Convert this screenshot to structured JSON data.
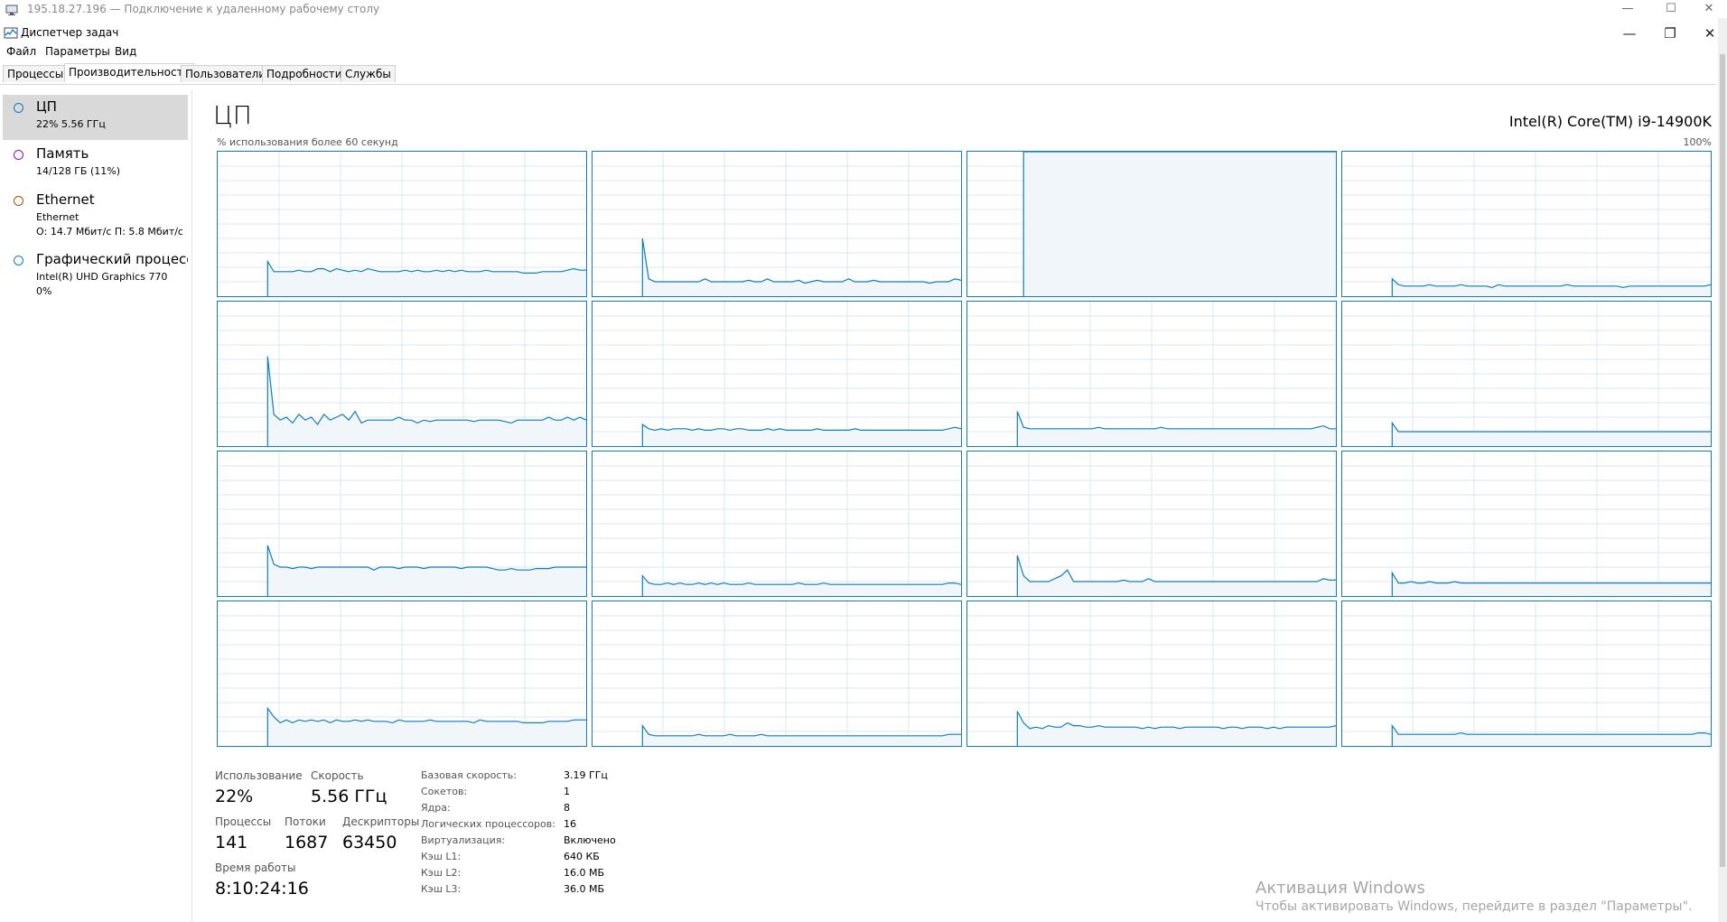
{
  "rdp": {
    "title": "195.18.27.196 — Подключение к удаленному рабочему столу",
    "minimize": "—",
    "maximize": "☐",
    "close": "✕"
  },
  "app": {
    "title": "Диспетчер задач",
    "minimize": "—",
    "restore": "❐",
    "close": "✕"
  },
  "menu": [
    "Файл",
    "Параметры",
    "Вид"
  ],
  "tabs": [
    "Процессы",
    "Производительность",
    "Пользователи",
    "Подробности",
    "Службы"
  ],
  "active_tab": "Производительность",
  "sidebar": {
    "items": [
      {
        "title": "ЦП",
        "sub1": "22%  5.56 ГГц",
        "sub2": "",
        "color": "#117dbb",
        "icon": "cpu-circle-icon"
      },
      {
        "title": "Память",
        "sub1": "14/128 ГБ (11%)",
        "sub2": "",
        "color": "#8b12ae",
        "icon": "memory-circle-icon"
      },
      {
        "title": "Ethernet",
        "sub1": "Ethernet",
        "sub2": "О: 14.7 Мбит/с  П: 5.8 Мбит/с",
        "color": "#a74f01",
        "icon": "ethernet-circle-icon"
      },
      {
        "title": "Графический процессор",
        "sub1": "Intel(R) UHD Graphics 770",
        "sub2": "0%",
        "color": "#117dbb",
        "icon": "gpu-circle-icon"
      }
    ]
  },
  "main": {
    "title": "ЦП",
    "cpu_name": "Intel(R) Core(TM) i9-14900K",
    "graph_caption": "% использования более 60 секунд",
    "graph_max": "100%"
  },
  "stats": {
    "usage_label": "Использование",
    "usage_value": "22%",
    "speed_label": "Скорость",
    "speed_value": "5.56 ГГц",
    "processes_label": "Процессы",
    "processes_value": "141",
    "threads_label": "Потоки",
    "threads_value": "1687",
    "handles_label": "Дескрипторы",
    "handles_value": "63450",
    "uptime_label": "Время работы",
    "uptime_value": "8:10:24:16"
  },
  "specs": [
    {
      "label": "Базовая скорость:",
      "value": "3.19 ГГц"
    },
    {
      "label": "Сокетов:",
      "value": "1"
    },
    {
      "label": "Ядра:",
      "value": "8"
    },
    {
      "label": "Логических процессоров:",
      "value": "16"
    },
    {
      "label": "Виртуализация:",
      "value": "Включено"
    },
    {
      "label": "Кэш L1:",
      "value": "640 КБ"
    },
    {
      "label": "Кэш L2:",
      "value": "16.0 МБ"
    },
    {
      "label": "Кэш L3:",
      "value": "36.0 МБ"
    }
  ],
  "activation": {
    "title": "Активация Windows",
    "subtitle": "Чтобы активировать Windows, перейдите в раздел \"Параметры\"."
  },
  "colors": {
    "graph_line": "#117dbb",
    "graph_fill": "#f1f6fa",
    "grid": "#d9eaf4",
    "selected": "#d9d9d9"
  },
  "chart_data": {
    "type": "area",
    "title": "% использования более 60 секунд",
    "ylim": [
      0,
      100
    ],
    "grid": true,
    "x_samples": 60,
    "series": [
      {
        "values": [
          0,
          0,
          0,
          0,
          0,
          0,
          0,
          0,
          24,
          17,
          17,
          17,
          17,
          18,
          17,
          17,
          19,
          19,
          17,
          19,
          18,
          17,
          18,
          17,
          19,
          18,
          17,
          17,
          17,
          17,
          18,
          17,
          18,
          17,
          17,
          18,
          17,
          18,
          17,
          18,
          17,
          17,
          17,
          18,
          17,
          17,
          17,
          17,
          17,
          16,
          16,
          16,
          17,
          17,
          17,
          17,
          18,
          19,
          18,
          18
        ]
      },
      {
        "values": [
          0,
          0,
          0,
          0,
          0,
          0,
          0,
          0,
          40,
          12,
          10,
          10,
          10,
          10,
          10,
          10,
          10,
          10,
          12,
          10,
          10,
          10,
          10,
          10,
          10,
          11,
          10,
          10,
          12,
          10,
          10,
          10,
          10,
          11,
          9,
          10,
          11,
          10,
          10,
          10,
          10,
          12,
          10,
          10,
          10,
          11,
          10,
          10,
          10,
          10,
          10,
          10,
          10,
          10,
          9,
          10,
          10,
          10,
          12,
          11
        ]
      },
      {
        "values": [
          0,
          0,
          0,
          0,
          0,
          0,
          0,
          0,
          0,
          100,
          100,
          100,
          100,
          100,
          100,
          100,
          100,
          100,
          100,
          100,
          100,
          100,
          100,
          100,
          100,
          100,
          100,
          100,
          100,
          100,
          100,
          100,
          100,
          100,
          100,
          100,
          100,
          100,
          100,
          100,
          100,
          100,
          100,
          100,
          100,
          100,
          100,
          100,
          100,
          100,
          100,
          100,
          100,
          100,
          100,
          100,
          100,
          100,
          100,
          100
        ]
      },
      {
        "values": [
          0,
          0,
          0,
          0,
          0,
          0,
          0,
          0,
          12,
          8,
          7,
          7,
          7,
          7,
          8,
          7,
          7,
          7,
          7,
          8,
          7,
          7,
          7,
          7,
          6,
          8,
          7,
          7,
          7,
          7,
          7,
          7,
          7,
          7,
          7,
          7,
          8,
          7,
          7,
          7,
          7,
          7,
          7,
          7,
          7,
          6,
          7,
          7,
          7,
          7,
          7,
          7,
          7,
          7,
          7,
          7,
          7,
          7,
          7,
          8
        ]
      },
      {
        "values": [
          0,
          0,
          0,
          0,
          0,
          0,
          0,
          0,
          62,
          22,
          18,
          20,
          16,
          22,
          18,
          20,
          15,
          22,
          18,
          20,
          22,
          18,
          24,
          16,
          18,
          18,
          18,
          18,
          18,
          20,
          18,
          18,
          16,
          18,
          17,
          18,
          18,
          18,
          18,
          18,
          18,
          17,
          18,
          18,
          18,
          18,
          17,
          16,
          18,
          18,
          18,
          18,
          18,
          20,
          18,
          18,
          20,
          18,
          20,
          18
        ]
      },
      {
        "values": [
          0,
          0,
          0,
          0,
          0,
          0,
          0,
          0,
          15,
          12,
          11,
          12,
          11,
          12,
          12,
          12,
          11,
          12,
          11,
          11,
          12,
          12,
          11,
          12,
          12,
          11,
          11,
          11,
          12,
          11,
          12,
          11,
          11,
          11,
          11,
          11,
          12,
          11,
          11,
          11,
          11,
          11,
          12,
          11,
          11,
          11,
          11,
          11,
          11,
          11,
          11,
          11,
          11,
          11,
          11,
          11,
          11,
          12,
          13,
          12
        ]
      },
      {
        "values": [
          0,
          0,
          0,
          0,
          0,
          0,
          0,
          0,
          24,
          13,
          12,
          12,
          12,
          12,
          12,
          12,
          12,
          12,
          12,
          12,
          12,
          13,
          12,
          12,
          12,
          12,
          12,
          12,
          12,
          12,
          12,
          13,
          12,
          12,
          12,
          12,
          12,
          12,
          12,
          12,
          12,
          12,
          12,
          12,
          12,
          12,
          12,
          12,
          12,
          12,
          12,
          12,
          12,
          12,
          12,
          12,
          13,
          14,
          12,
          12
        ]
      },
      {
        "values": [
          0,
          0,
          0,
          0,
          0,
          0,
          0,
          0,
          16,
          10,
          10,
          10,
          10,
          10,
          10,
          10,
          10,
          10,
          10,
          10,
          10,
          10,
          10,
          10,
          10,
          10,
          10,
          10,
          10,
          10,
          10,
          10,
          10,
          10,
          10,
          10,
          10,
          10,
          10,
          10,
          10,
          10,
          10,
          10,
          10,
          10,
          10,
          10,
          10,
          10,
          10,
          10,
          10,
          10,
          10,
          10,
          10,
          10,
          10,
          10
        ]
      },
      {
        "values": [
          0,
          0,
          0,
          0,
          0,
          0,
          0,
          0,
          35,
          22,
          20,
          20,
          19,
          20,
          20,
          19,
          20,
          20,
          20,
          20,
          20,
          20,
          20,
          20,
          20,
          18,
          20,
          20,
          20,
          19,
          20,
          20,
          20,
          19,
          20,
          20,
          20,
          20,
          20,
          19,
          20,
          20,
          20,
          20,
          19,
          18,
          18,
          19,
          18,
          18,
          18,
          19,
          19,
          19,
          20,
          20,
          20,
          20,
          20,
          20
        ]
      },
      {
        "values": [
          0,
          0,
          0,
          0,
          0,
          0,
          0,
          0,
          14,
          9,
          8,
          8,
          9,
          8,
          9,
          8,
          8,
          9,
          8,
          9,
          8,
          9,
          8,
          8,
          8,
          9,
          8,
          8,
          8,
          8,
          8,
          8,
          8,
          9,
          8,
          8,
          8,
          9,
          8,
          8,
          8,
          8,
          8,
          8,
          8,
          8,
          8,
          8,
          8,
          8,
          8,
          8,
          8,
          8,
          8,
          8,
          8,
          9,
          9,
          8
        ]
      },
      {
        "values": [
          0,
          0,
          0,
          0,
          0,
          0,
          0,
          0,
          28,
          14,
          10,
          10,
          10,
          10,
          12,
          14,
          18,
          10,
          10,
          10,
          10,
          10,
          10,
          10,
          10,
          11,
          10,
          10,
          10,
          12,
          10,
          10,
          10,
          10,
          10,
          10,
          10,
          10,
          10,
          10,
          10,
          10,
          10,
          10,
          10,
          10,
          10,
          10,
          10,
          10,
          10,
          10,
          10,
          10,
          10,
          10,
          10,
          12,
          11,
          11
        ]
      },
      {
        "values": [
          0,
          0,
          0,
          0,
          0,
          0,
          0,
          0,
          16,
          9,
          9,
          10,
          9,
          9,
          10,
          9,
          9,
          9,
          10,
          9,
          9,
          9,
          9,
          9,
          9,
          9,
          9,
          9,
          9,
          9,
          9,
          9,
          9,
          9,
          9,
          9,
          9,
          9,
          9,
          9,
          9,
          9,
          9,
          9,
          9,
          9,
          9,
          9,
          9,
          9,
          9,
          9,
          9,
          9,
          9,
          9,
          9,
          9,
          9,
          9
        ]
      },
      {
        "values": [
          0,
          0,
          0,
          0,
          0,
          0,
          0,
          0,
          26,
          20,
          16,
          18,
          16,
          18,
          17,
          18,
          17,
          18,
          16,
          18,
          17,
          17,
          18,
          17,
          18,
          17,
          17,
          17,
          16,
          18,
          17,
          17,
          17,
          17,
          18,
          17,
          17,
          17,
          17,
          17,
          17,
          16,
          18,
          17,
          17,
          17,
          17,
          17,
          17,
          16,
          16,
          16,
          16,
          17,
          17,
          17,
          17,
          18,
          18,
          18
        ]
      },
      {
        "values": [
          0,
          0,
          0,
          0,
          0,
          0,
          0,
          0,
          14,
          8,
          7,
          7,
          7,
          7,
          7,
          7,
          7,
          8,
          7,
          7,
          7,
          7,
          8,
          7,
          7,
          7,
          7,
          8,
          7,
          7,
          7,
          7,
          7,
          7,
          7,
          7,
          7,
          7,
          7,
          7,
          7,
          7,
          7,
          7,
          7,
          7,
          7,
          7,
          7,
          7,
          7,
          7,
          7,
          7,
          7,
          7,
          7,
          8,
          8,
          8
        ]
      },
      {
        "values": [
          0,
          0,
          0,
          0,
          0,
          0,
          0,
          0,
          24,
          16,
          12,
          13,
          12,
          14,
          13,
          13,
          16,
          14,
          14,
          13,
          13,
          14,
          13,
          13,
          13,
          13,
          13,
          13,
          12,
          13,
          12,
          13,
          13,
          13,
          12,
          13,
          13,
          13,
          13,
          13,
          13,
          12,
          13,
          13,
          12,
          13,
          13,
          13,
          12,
          13,
          12,
          13,
          13,
          13,
          13,
          13,
          13,
          13,
          13,
          14
        ]
      },
      {
        "values": [
          0,
          0,
          0,
          0,
          0,
          0,
          0,
          0,
          14,
          8,
          8,
          8,
          8,
          8,
          8,
          8,
          8,
          8,
          8,
          9,
          8,
          8,
          8,
          8,
          8,
          8,
          8,
          8,
          8,
          8,
          8,
          8,
          8,
          8,
          8,
          8,
          8,
          8,
          8,
          8,
          8,
          8,
          8,
          8,
          8,
          8,
          8,
          8,
          8,
          8,
          8,
          8,
          8,
          8,
          8,
          8,
          8,
          9,
          9,
          8
        ]
      }
    ]
  }
}
